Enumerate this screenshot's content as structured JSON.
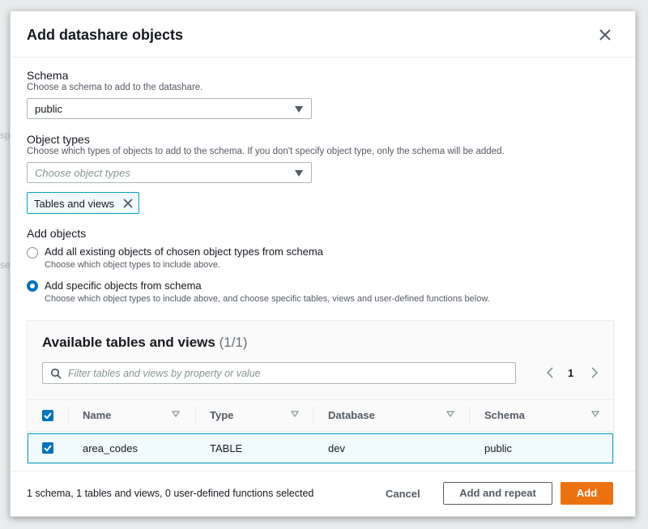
{
  "modal": {
    "title": "Add datashare objects"
  },
  "backdrop": {
    "fragment_1": "sp",
    "fragment_2": "se"
  },
  "schema": {
    "label": "Schema",
    "description": "Choose a schema to add to the datashare.",
    "selected": "public"
  },
  "object_types": {
    "label": "Object types",
    "description": "Choose which types of objects to add to the schema. If you don't specify object type, only the schema will be added.",
    "placeholder": "Choose object types",
    "tokens": [
      "Tables and views"
    ]
  },
  "add_objects": {
    "label": "Add objects",
    "options": [
      {
        "label": "Add all existing objects of chosen object types from schema",
        "description": "Choose which object types to include above.",
        "selected": false
      },
      {
        "label": "Add specific objects from schema",
        "description": "Choose which object types to include above, and choose specific tables, views and user-defined functions below.",
        "selected": true
      }
    ]
  },
  "table": {
    "title": "Available tables and views",
    "count": "(1/1)",
    "filter_placeholder": "Filter tables and views by property or value",
    "page": "1",
    "columns": [
      "Name",
      "Type",
      "Database",
      "Schema"
    ],
    "rows": [
      {
        "name": "area_codes",
        "type": "TABLE",
        "database": "dev",
        "schema": "public",
        "selected": true
      }
    ]
  },
  "footer": {
    "status": "1 schema, 1 tables and views, 0 user-defined functions selected",
    "cancel": "Cancel",
    "add_and_repeat": "Add and repeat",
    "add": "Add"
  },
  "colors": {
    "primary_button": "#ec7211",
    "accent_blue": "#0073bb",
    "selection_border": "#00a1c9",
    "selection_bg": "#f1faff"
  }
}
